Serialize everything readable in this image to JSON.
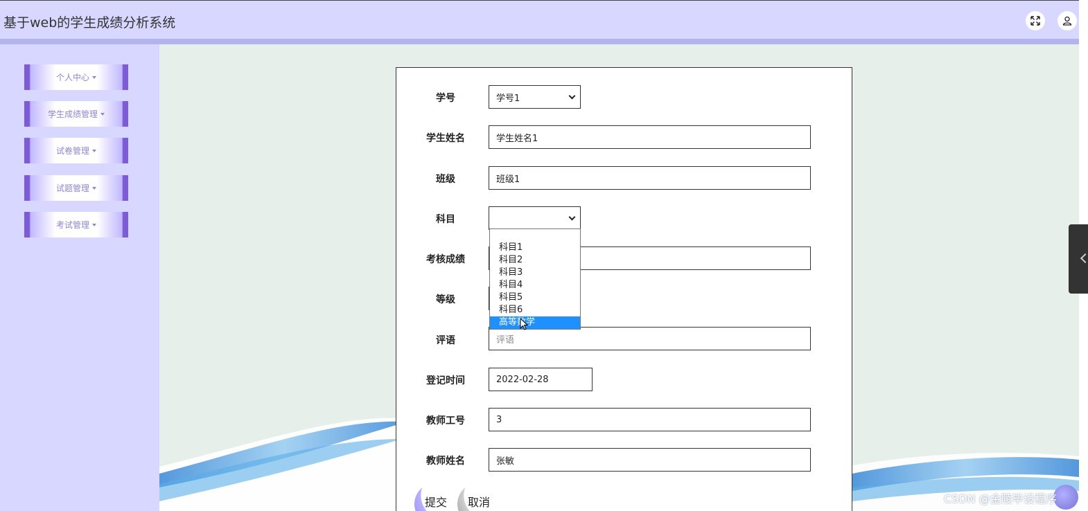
{
  "app": {
    "title": "基于web的学生成绩分析系统"
  },
  "header": {
    "fullscreen_icon": "fullscreen-icon",
    "user_icon": "user-icon"
  },
  "sidebar": {
    "items": [
      {
        "label": "个人中心"
      },
      {
        "label": "学生成绩管理"
      },
      {
        "label": "试卷管理"
      },
      {
        "label": "试题管理"
      },
      {
        "label": "考试管理"
      }
    ]
  },
  "form": {
    "student_id": {
      "label": "学号",
      "value": "学号1"
    },
    "student_name": {
      "label": "学生姓名",
      "value": "学生姓名1"
    },
    "class": {
      "label": "班级",
      "value": "班级1"
    },
    "subject": {
      "label": "科目",
      "value": "",
      "options": [
        "科目1",
        "科目2",
        "科目3",
        "科目4",
        "科目5",
        "科目6",
        "高等数学"
      ],
      "highlighted": "高等数学"
    },
    "score": {
      "label": "考核成绩",
      "value": ""
    },
    "grade": {
      "label": "等级",
      "value": ""
    },
    "comment": {
      "label": "评语",
      "placeholder": "评语"
    },
    "register_time": {
      "label": "登记时间",
      "value": "2022-02-28"
    },
    "teacher_id": {
      "label": "教师工号",
      "value": "3"
    },
    "teacher_name": {
      "label": "教师姓名",
      "value": "张敏"
    },
    "submit_label": "提交",
    "cancel_label": "取消"
  },
  "watermark": "CSDN @金陵毕设程序",
  "colors": {
    "header_bg": "#d7d7ff",
    "sidebar_accent": "#7b5bd6",
    "main_bg": "#e6efe9",
    "highlight": "#1e90ff"
  }
}
